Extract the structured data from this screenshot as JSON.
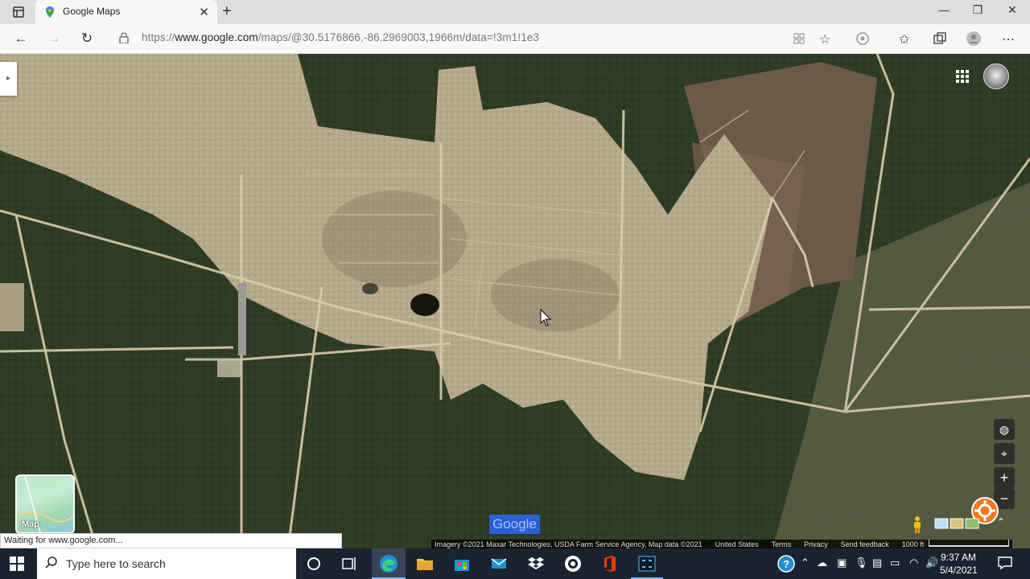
{
  "browser": {
    "tab_title": "Google Maps",
    "url_prefix": "https://",
    "url_domain": "www.google.com",
    "url_path": "/maps/@30.5176866,-86.2969003,1966m/data=!3m1!1e3"
  },
  "map": {
    "layer_label": "Map",
    "google_logo": "Google",
    "attribution": "Imagery ©2021 Maxar Technologies, USDA Farm Service Agency, Map data ©2021",
    "country": "United States",
    "terms": "Terms",
    "privacy": "Privacy",
    "feedback": "Send feedback",
    "scale": "1000 ft"
  },
  "status_bar": "Waiting for www.google.com...",
  "taskbar": {
    "search_placeholder": "Type here to search",
    "time": "9:37 AM",
    "date": "5/4/2021"
  },
  "colors": {
    "taskbar": "#1c2330",
    "forest": "#2d3a24",
    "clearing": "#b9ad8c"
  }
}
